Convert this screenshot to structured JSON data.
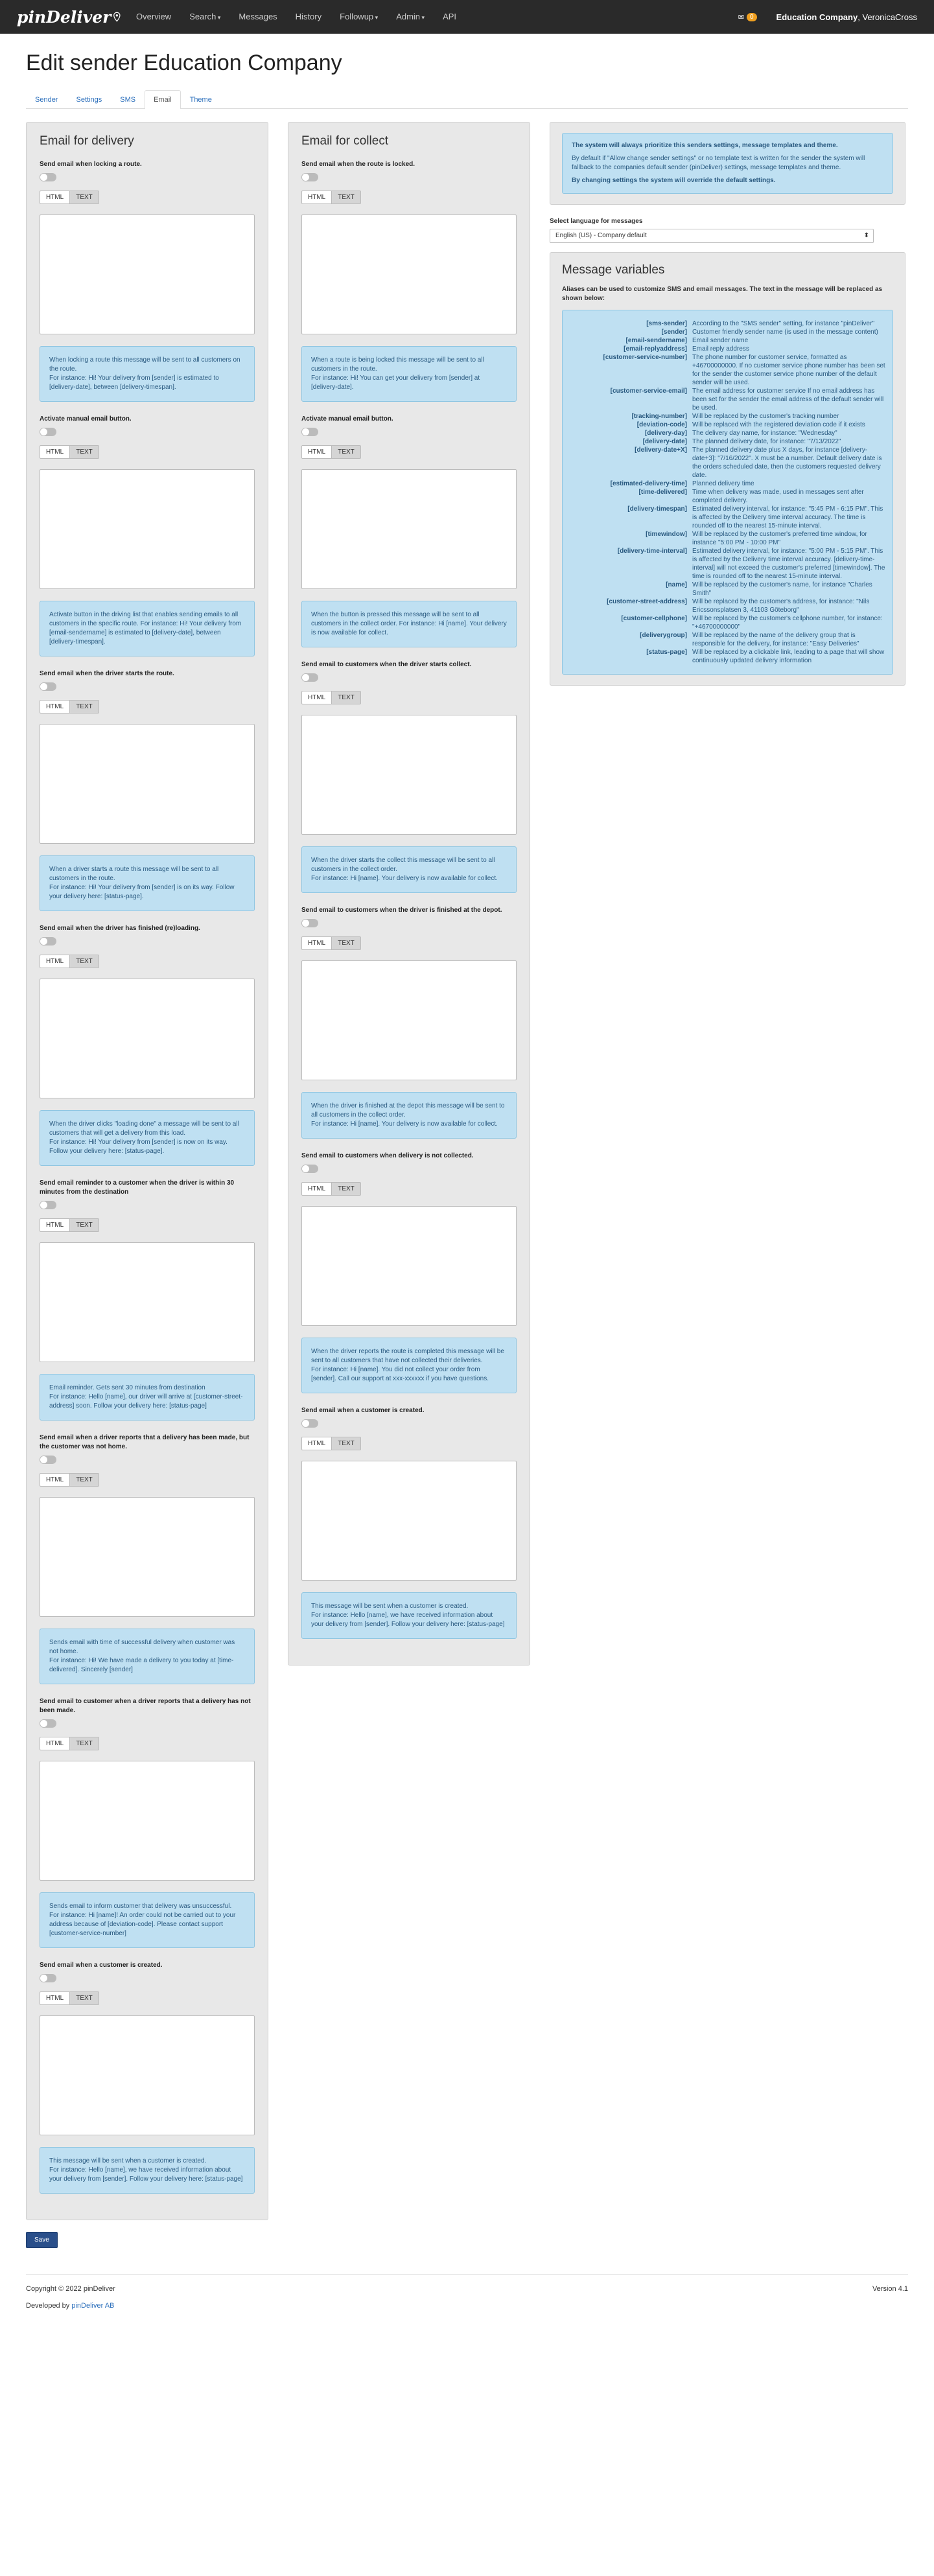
{
  "nav": {
    "logo": "pinDeliver",
    "items": [
      "Overview",
      "Search",
      "Messages",
      "History",
      "Followup",
      "Admin",
      "API"
    ],
    "badge": "0",
    "company": "Education Company",
    "user": "VeronicaCross"
  },
  "page": {
    "title": "Edit sender Education Company"
  },
  "tabs": [
    "Sender",
    "Settings",
    "SMS",
    "Email",
    "Theme"
  ],
  "html_label": "HTML",
  "text_label": "TEXT",
  "delivery": {
    "title": "Email for delivery",
    "sections": [
      {
        "label": "Send email when locking a route.",
        "info": [
          "When locking a route this message will be sent to all customers on the route.",
          "For instance: Hi! Your delivery from [sender] is estimated to [delivery-date], between [delivery-timespan]."
        ]
      },
      {
        "label": "Activate manual email button.",
        "info": [
          "Activate button in the driving list that enables sending emails to all customers in the specific route. For instance: Hi! Your delivery from [email-sendername] is estimated to [delivery-date], between [delivery-timespan]."
        ]
      },
      {
        "label": "Send email when the driver starts the route.",
        "info": [
          "When a driver starts a route this message will be sent to all customers in the route.",
          "For instance: Hi! Your delivery from [sender] is on its way. Follow your delivery here: [status-page]."
        ]
      },
      {
        "label": "Send email when the driver has finished (re)loading.",
        "info": [
          "When the driver clicks \"loading done\" a message will be sent to all customers that will get a delivery from this load.",
          "For instance: Hi! Your delivery from [sender] is now on its way. Follow your delivery here: [status-page]."
        ]
      },
      {
        "label": "Send email reminder to a customer when the driver is within 30 minutes from the destination",
        "info": [
          "Email reminder. Gets sent 30 minutes from destination",
          "For instance: Hello [name], our driver will arrive at [customer-street-address] soon. Follow your delivery here: [status-page]"
        ]
      },
      {
        "label": "Send email when a driver reports that a delivery has been made, but the customer was not home.",
        "info": [
          "Sends email with time of successful delivery when customer was not home.",
          "For instance: Hi! We have made a delivery to you today at [time-delivered]. Sincerely [sender]"
        ]
      },
      {
        "label": "Send email to customer when a driver reports that a delivery has not been made.",
        "info": [
          "Sends email to inform customer that delivery was unsuccessful.",
          "For instance: Hi [name]! An order could not be carried out to your address because of [deviation-code]. Please contact support [customer-service-number]"
        ]
      },
      {
        "label": "Send email when a customer is created.",
        "info": [
          "This message will be sent when a customer is created.",
          "For instance: Hello [name], we have received information about your delivery from [sender]. Follow your delivery here: [status-page]"
        ]
      }
    ]
  },
  "collect": {
    "title": "Email for collect",
    "sections": [
      {
        "label": "Send email when the route is locked.",
        "info": [
          "When a route is being locked this message will be sent to all customers in the route.",
          "For instance: Hi! You can get your delivery from [sender] at [delivery-date]."
        ]
      },
      {
        "label": "Activate manual email button.",
        "info": [
          "When the button is pressed this message will be sent to all customers in the collect order. For instance: Hi [name]. Your delivery is now available for collect."
        ]
      },
      {
        "label": "Send email to customers when the driver starts collect.",
        "info": [
          "When the driver starts the collect this message will be sent to all customers in the collect order.",
          "For instance: Hi [name]. Your delivery is now available for collect."
        ]
      },
      {
        "label": "Send email to customers when the driver is finished at the depot.",
        "info": [
          "When the driver is finished at the depot this message will be sent to all customers in the collect order.",
          "For instance: Hi [name]. Your delivery is now available for collect."
        ]
      },
      {
        "label": "Send email to customers when delivery is not collected.",
        "info": [
          "When the driver reports the route is completed this message will be sent to all customers that have not collected their deliveries.",
          "For instance: Hi [name]. You did not collect your order from [sender]. Call our support at xxx-xxxxxx if you have questions."
        ]
      },
      {
        "label": "Send email when a customer is created.",
        "info": [
          "This message will be sent when a customer is created.",
          "For instance: Hello [name], we have received information about your delivery from [sender]. Follow your delivery here: [status-page]"
        ]
      }
    ]
  },
  "right": {
    "notice_bold": "The system will always prioritize this senders settings, message templates and theme.",
    "notice_text": "By default if \"Allow change sender settings\" or no template text is written for the sender the system will fallback to the companies default sender (pinDeliver) settings, message templates and theme.",
    "notice_bold2": "By changing settings the system will override the default settings.",
    "lang_label": "Select language for messages",
    "lang_value": "English (US) - Company default",
    "vars_title": "Message variables",
    "vars_intro": "Aliases can be used to customize SMS and email messages. The text in the message will be replaced as shown below:",
    "vars": [
      {
        "k": "[sms-sender]",
        "v": "According to the \"SMS sender\" setting, for instance \"pinDeliver\""
      },
      {
        "k": "[sender]",
        "v": "Customer friendly sender name (is used in the message content)"
      },
      {
        "k": "[email-sendername]",
        "v": "Email sender name"
      },
      {
        "k": "[email-replyaddress]",
        "v": "Email reply address"
      },
      {
        "k": "[customer-service-number]",
        "v": "The phone number for customer service, formatted as +46700000000. If no customer service phone number has been set for the sender the customer service phone number of the default sender will be used."
      },
      {
        "k": "[customer-service-email]",
        "v": "The email address for customer service If no email address has been set for the sender the email address of the default sender will be used."
      },
      {
        "k": "[tracking-number]",
        "v": "Will be replaced by the customer's tracking number"
      },
      {
        "k": "[deviation-code]",
        "v": "Will be replaced with the registered deviation code if it exists"
      },
      {
        "k": "[delivery-day]",
        "v": "The delivery day name, for instance: \"Wednesday\""
      },
      {
        "k": "[delivery-date]",
        "v": "The planned delivery date, for instance: \"7/13/2022\""
      },
      {
        "k": "[delivery-date+X]",
        "v": "The planned delivery date plus X days, for instance [delivery-date+3]: \"7/16/2022\". X must be a number. Default delivery date is the orders scheduled date, then the customers requested delivery date."
      },
      {
        "k": "[estimated-delivery-time]",
        "v": "Planned delivery time"
      },
      {
        "k": "[time-delivered]",
        "v": "Time when delivery was made, used in messages sent after completed delivery."
      },
      {
        "k": "[delivery-timespan]",
        "v": "Estimated delivery interval, for instance: \"5:45 PM - 6:15 PM\". This is affected by the Delivery time interval accuracy. The time is rounded off to the nearest 15-minute interval."
      },
      {
        "k": "[timewindow]",
        "v": "Will be replaced by the customer's preferred time window, for instance \"5:00 PM - 10:00 PM\""
      },
      {
        "k": "[delivery-time-interval]",
        "v": "Estimated delivery interval, for instance: \"5:00 PM - 5:15 PM\". This is affected by the Delivery time interval accuracy. [delivery-time-interval] will not exceed the customer's preferred [timewindow]. The time is rounded off to the nearest 15-minute interval."
      },
      {
        "k": "[name]",
        "v": "Will be replaced by the customer's name, for instance \"Charles Smith\""
      },
      {
        "k": "[customer-street-address]",
        "v": "Will be replaced by the customer's address, for instance: \"Nils Ericssonsplatsen 3, 41103 Göteborg\""
      },
      {
        "k": "[customer-cellphone]",
        "v": "Will be replaced by the customer's cellphone number, for instance: \"+46700000000\""
      },
      {
        "k": "[deliverygroup]",
        "v": "Will be replaced by the name of the delivery group that is responsible for the delivery, for instance: \"Easy Deliveries\""
      },
      {
        "k": "[status-page]",
        "v": "Will be replaced by a clickable link, leading to a page that will show continuously updated delivery information"
      }
    ]
  },
  "save_label": "Save",
  "footer": {
    "copyright": "Copyright © 2022 pinDeliver",
    "version": "Version 4.1",
    "developed_by": "Developed by",
    "developer": "pinDeliver AB"
  }
}
